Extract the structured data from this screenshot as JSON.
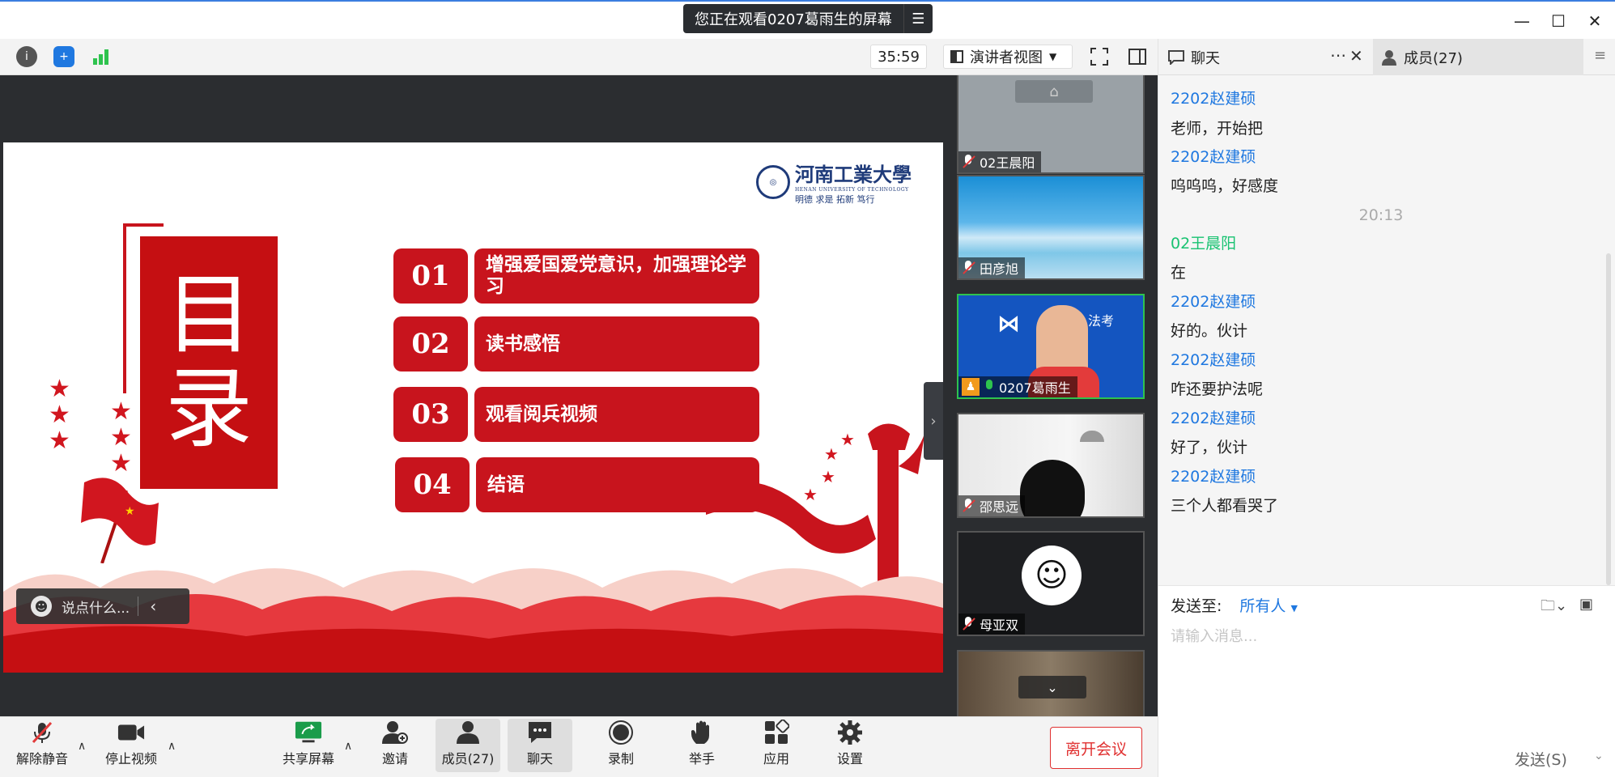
{
  "share_banner": {
    "text": "您正在观看0207葛雨生的屏幕",
    "menu_icon": "list-menu-icon"
  },
  "toolbar": {
    "timer": "35:59",
    "view_label": "演讲者视图"
  },
  "slide": {
    "logo_cn": "河南工業大學",
    "logo_en": "HENAN UNIVERSITY OF TECHNOLOGY",
    "logo_motto": "明德 求是 拓新 笃行",
    "toc_title_1": "目",
    "toc_title_2": "录",
    "items": [
      {
        "num": "01",
        "label": "增强爱国爱党意识，加强理论学习"
      },
      {
        "num": "02",
        "label": "读书感悟"
      },
      {
        "num": "03",
        "label": "观看阅兵视频"
      },
      {
        "num": "04",
        "label": "结语"
      }
    ]
  },
  "reaction_bar": {
    "placeholder": "说点什么..."
  },
  "participants": [
    {
      "name": "02王晨阳"
    },
    {
      "name": "田彦旭"
    },
    {
      "name": "0207葛雨生"
    },
    {
      "name": "邵思远"
    },
    {
      "name": "母亚双"
    }
  ],
  "bottom_bar": {
    "unmute": "解除静音",
    "stop_video": "停止视频",
    "share_screen": "共享屏幕",
    "invite": "邀请",
    "members": "成员(27)",
    "chat": "聊天",
    "record": "录制",
    "raise_hand": "举手",
    "apps": "应用",
    "settings": "设置",
    "leave": "离开会议"
  },
  "panel": {
    "chat_tab": "聊天",
    "members_tab": "成员(27)",
    "messages": [
      {
        "kind": "sender",
        "text": "2202赵建硕"
      },
      {
        "kind": "body",
        "text": "老师，开始把"
      },
      {
        "kind": "sender",
        "text": "2202赵建硕"
      },
      {
        "kind": "body",
        "text": "呜呜呜，好感度"
      },
      {
        "kind": "time",
        "text": "20:13"
      },
      {
        "kind": "sender-green",
        "text": "02王晨阳"
      },
      {
        "kind": "body",
        "text": "在"
      },
      {
        "kind": "sender",
        "text": "2202赵建硕"
      },
      {
        "kind": "body",
        "text": "好的。伙计"
      },
      {
        "kind": "sender",
        "text": "2202赵建硕"
      },
      {
        "kind": "body",
        "text": "咋还要护法呢"
      },
      {
        "kind": "sender",
        "text": "2202赵建硕"
      },
      {
        "kind": "body",
        "text": "好了，伙计"
      },
      {
        "kind": "sender",
        "text": "2202赵建硕"
      },
      {
        "kind": "body",
        "text": "三个人都看哭了"
      }
    ],
    "send_to_label": "发送至:",
    "send_to_value": "所有人",
    "input_placeholder": "请输入消息...",
    "send_button": "发送(S)"
  },
  "colors": {
    "accent_blue": "#1f78e0",
    "green_name": "#18c271",
    "slide_red": "#c8141d",
    "leave_red": "#e03030"
  }
}
